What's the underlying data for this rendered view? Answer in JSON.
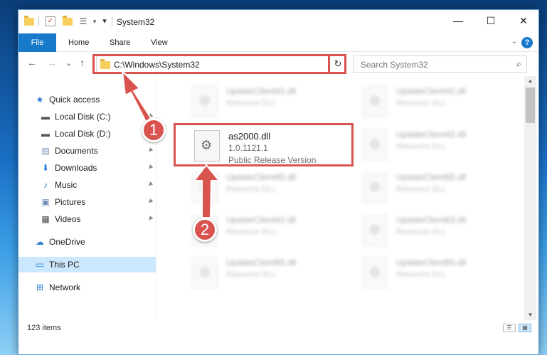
{
  "window": {
    "title": "System32",
    "quick_access_dropdown": "▾",
    "minimize": "—",
    "maximize": "☐",
    "close": "✕"
  },
  "ribbon": {
    "file": "File",
    "tabs": [
      "Home",
      "Share",
      "View"
    ],
    "help": "?",
    "expand": "⌄"
  },
  "nav": {
    "back": "←",
    "forward": "→",
    "recent": "⌄",
    "up": "↑",
    "address": "C:\\Windows\\System32",
    "address_dropdown": "⌄",
    "refresh": "↻",
    "search_placeholder": "Search System32",
    "search_icon": "⌕"
  },
  "sidebar": {
    "items": [
      {
        "label": "Quick access",
        "icon": "star-icon",
        "glyph": "★",
        "color": "#2b7cd3"
      },
      {
        "label": "Local Disk (C:)",
        "icon": "drive-icon",
        "glyph": "▬",
        "color": "#555555",
        "pinned": true
      },
      {
        "label": "Local Disk (D:)",
        "icon": "drive-icon",
        "glyph": "▬",
        "color": "#555555"
      },
      {
        "label": "Documents",
        "icon": "documents-icon",
        "glyph": "▤",
        "color": "#6f8fb8",
        "pinned": true
      },
      {
        "label": "Downloads",
        "icon": "download-icon",
        "glyph": "⬇",
        "color": "#2b7cd3",
        "pinned": true
      },
      {
        "label": "Music",
        "icon": "music-icon",
        "glyph": "♪",
        "color": "#2b7cd3",
        "pinned": true
      },
      {
        "label": "Pictures",
        "icon": "pictures-icon",
        "glyph": "▣",
        "color": "#6f8fb8",
        "pinned": true
      },
      {
        "label": "Videos",
        "icon": "videos-icon",
        "glyph": "▦",
        "color": "#444444",
        "pinned": true
      },
      {
        "label": "OneDrive",
        "icon": "cloud-icon",
        "glyph": "☁",
        "color": "#2b7cd3"
      },
      {
        "label": "This PC",
        "icon": "computer-icon",
        "glyph": "▭",
        "color": "#2b7cd3",
        "selected": true
      },
      {
        "label": "Network",
        "icon": "network-icon",
        "glyph": "⊞",
        "color": "#2b7cd3"
      }
    ],
    "pin_glyph": "📌"
  },
  "content": {
    "focused_file": {
      "name": "as2000.dll",
      "version": "1.0.1121.1",
      "description": "Public Release Version"
    },
    "background_files": [
      {
        "name": "UpdateClient42.dll",
        "type": "Resource DLL"
      },
      {
        "name": "UpdateClient42.dll",
        "type": "Resource DLL"
      },
      {
        "name": "UpdateClient42.dll",
        "type": "Resource DLL"
      },
      {
        "name": "UpdateClient65.dll",
        "type": "Resource DLL"
      },
      {
        "name": "UpdateClient65.dll",
        "type": "Resource DLL"
      },
      {
        "name": "UpdateClient42.dll",
        "type": "Resource DLL"
      },
      {
        "name": "UpdateClient63.dll",
        "type": "Resource DLL"
      },
      {
        "name": "UpdateClient65.dll",
        "type": "Resource DLL"
      },
      {
        "name": "UpdateClient65.dll",
        "type": "Resource DLL"
      }
    ]
  },
  "status": {
    "item_count": "123 items"
  },
  "annotations": {
    "callout_1": "1",
    "callout_2": "2",
    "highlight_color": "#d9534f"
  }
}
